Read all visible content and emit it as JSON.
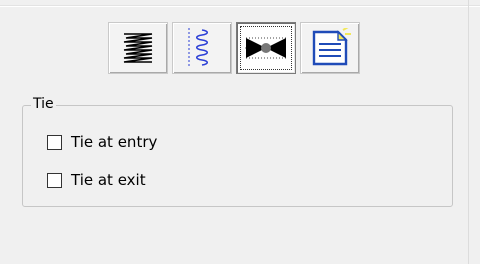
{
  "toolbar": {
    "buttons": [
      {
        "icon": "zigzag-lines-icon",
        "state": "raised"
      },
      {
        "icon": "coil-spring-icon",
        "state": "raised"
      },
      {
        "icon": "bowtie-tie-icon",
        "state": "pressed"
      },
      {
        "icon": "note-page-icon",
        "state": "raised"
      }
    ]
  },
  "tie_group": {
    "legend": "Tie",
    "options": [
      {
        "label": "Tie at entry",
        "checked": false
      },
      {
        "label": "Tie at exit",
        "checked": false
      }
    ]
  },
  "colors": {
    "background": "#f0f0f0",
    "coil_blue": "#2b3fd6",
    "note_blue": "#1f4bb8",
    "note_highlight": "#f2e85a"
  }
}
